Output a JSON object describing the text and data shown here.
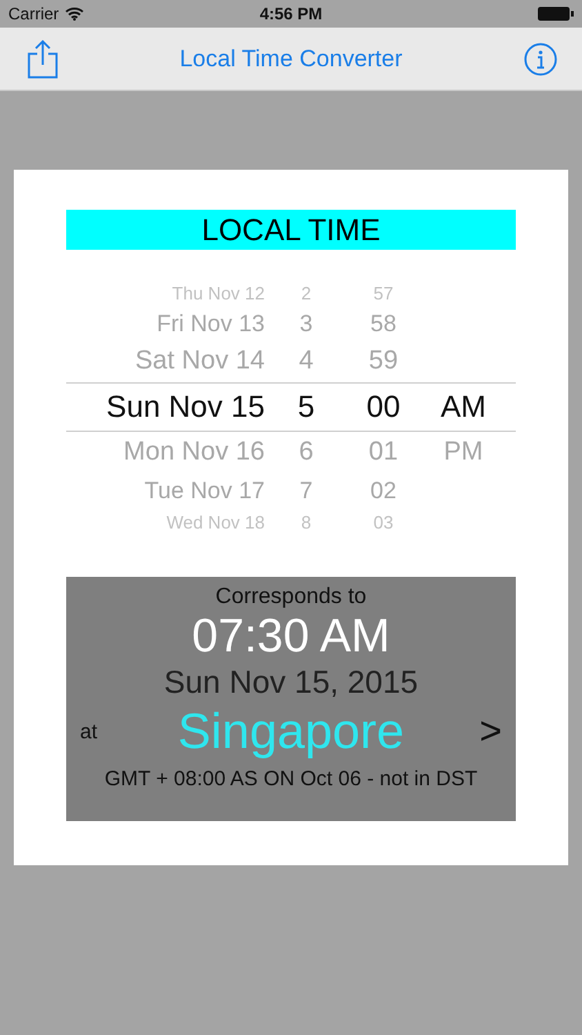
{
  "status_bar": {
    "carrier": "Carrier",
    "time": "4:56 PM"
  },
  "nav_bar": {
    "title": "Local Time Converter"
  },
  "header": "LOCAL TIME",
  "picker": {
    "rows": [
      {
        "date": "Thu Nov 12",
        "hour": "2",
        "minute": "57",
        "selected": false
      },
      {
        "date": "Fri Nov 13",
        "hour": "3",
        "minute": "58",
        "selected": false
      },
      {
        "date": "Sat Nov 14",
        "hour": "4",
        "minute": "59",
        "selected": false
      },
      {
        "date": "Sun Nov 15",
        "hour": "5",
        "minute": "00",
        "period": "AM",
        "selected": true
      },
      {
        "date": "Mon Nov 16",
        "hour": "6",
        "minute": "01",
        "period": "PM",
        "selected": false
      },
      {
        "date": "Tue Nov 17",
        "hour": "7",
        "minute": "02",
        "selected": false
      },
      {
        "date": "Wed Nov 18",
        "hour": "8",
        "minute": "03",
        "selected": false
      }
    ]
  },
  "result": {
    "caption": "Corresponds to",
    "time": "07:30 AM",
    "date": "Sun Nov 15, 2015",
    "at": "at",
    "city": "Singapore",
    "chevron": ">",
    "zone_info": "GMT + 08:00 AS ON Oct 06 - not in DST"
  }
}
